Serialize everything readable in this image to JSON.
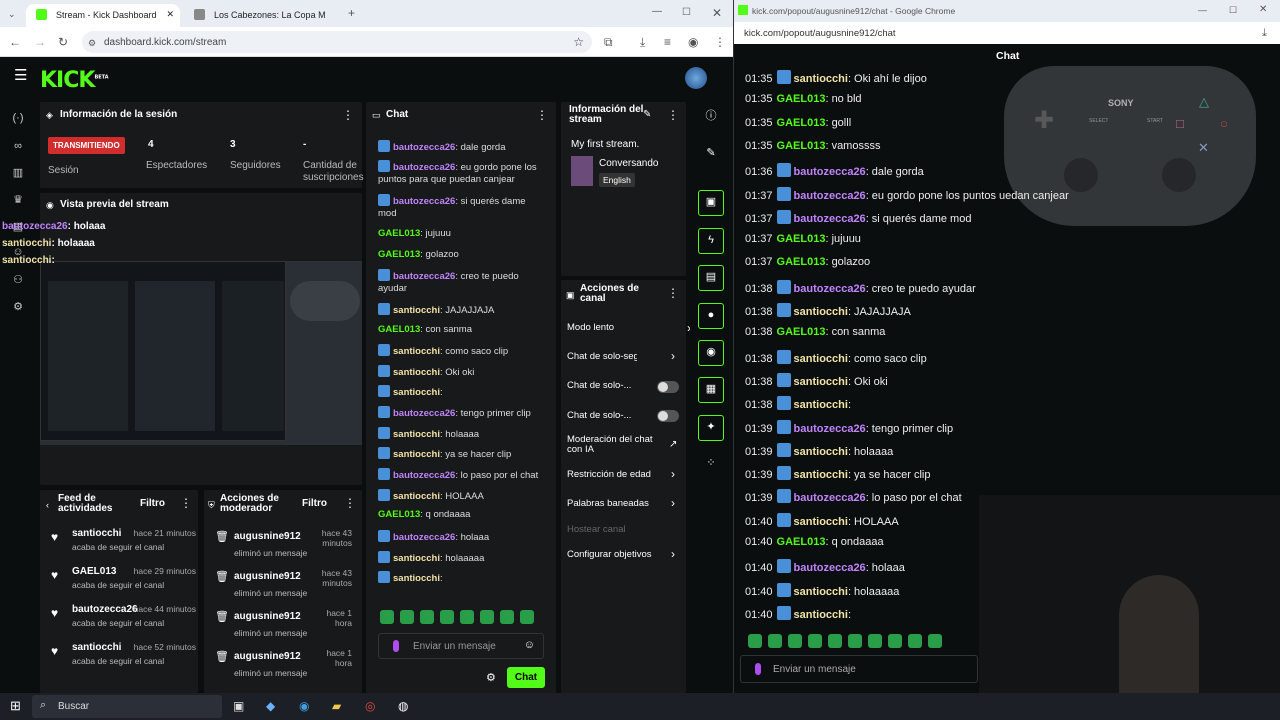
{
  "left_browser": {
    "tab1": "Stream - Kick Dashboard",
    "tab2": "Los Cabezones: La Copa M",
    "url": "dashboard.kick.com/stream"
  },
  "right_browser": {
    "title": "kick.com/popout/augusnine912/chat - Google Chrome",
    "url": "kick.com/popout/augusnine912/chat",
    "chat_title": "Chat"
  },
  "logo": "KICK",
  "logo_beta": "BETA",
  "session": {
    "title": "Información de la sesión",
    "live_label": "TRANSMITIENDO",
    "live_sub": "Sesión",
    "viewers": "4",
    "viewers_label": "Espectadores",
    "followers": "3",
    "followers_label": "Seguidores",
    "subs": "-",
    "subs_label": "Cantidad de suscripciones"
  },
  "preview": {
    "title": "Vista previa del stream",
    "overlay": [
      {
        "user": "bautozecca26",
        "text": ": holaaa"
      },
      {
        "user": "santiocchi",
        "text": ": holaaaa"
      },
      {
        "user": "santiocchi",
        "text": ":"
      }
    ]
  },
  "feed": {
    "title": "Feed de actividades",
    "filter": "Filtro",
    "items": [
      {
        "user": "santiocchi",
        "time": "hace 21 minutos",
        "action": "acaba de seguir el canal"
      },
      {
        "user": "GAEL013",
        "time": "hace 29 minutos",
        "action": "acaba de seguir el canal"
      },
      {
        "user": "bautozecca26",
        "time": "hace 44 minutos",
        "action": "acaba de seguir el canal"
      },
      {
        "user": "santiocchi",
        "time": "hace 52 minutos",
        "action": "acaba de seguir el canal"
      }
    ]
  },
  "modactions": {
    "title": "Acciones de moderador",
    "filter": "Filtro",
    "items": [
      {
        "user": "augusnine912",
        "time": "hace 43 minutos",
        "action": "eliminó un mensaje"
      },
      {
        "user": "augusnine912",
        "time": "hace 43 minutos",
        "action": "eliminó un mensaje"
      },
      {
        "user": "augusnine912",
        "time": "hace 1 hora",
        "action": "eliminó un mensaje"
      },
      {
        "user": "augusnine912",
        "time": "hace 1 hora",
        "action": "eliminó un mensaje"
      }
    ]
  },
  "chat": {
    "title": "Chat",
    "placeholder": "Enviar un mensaje",
    "send": "Chat",
    "messages": [
      {
        "u": "bautozecca26",
        "c": "b",
        "t": ": dale gorda"
      },
      {
        "u": "bautozecca26",
        "c": "b",
        "t": ": eu gordo pone los"
      },
      {
        "u": "",
        "c": "",
        "t": "puntos para que puedan canjear"
      },
      {
        "u": "bautozecca26",
        "c": "b",
        "t": ": si querés dame"
      },
      {
        "u": "",
        "c": "",
        "t": "mod"
      },
      {
        "u": "GAEL013",
        "c": "g",
        "t": ": jujuuu"
      },
      {
        "u": "GAEL013",
        "c": "g",
        "t": ": golazoo"
      },
      {
        "u": "bautozecca26",
        "c": "b",
        "t": ": creo te puedo"
      },
      {
        "u": "",
        "c": "",
        "t": "ayudar"
      },
      {
        "u": "santiocchi",
        "c": "y",
        "t": ": JAJAJJAJA"
      },
      {
        "u": "GAEL013",
        "c": "g",
        "t": ": con sanma"
      },
      {
        "u": "santiocchi",
        "c": "y",
        "t": ": como saco clip"
      },
      {
        "u": "santiocchi",
        "c": "y",
        "t": ": Oki oki"
      },
      {
        "u": "santiocchi",
        "c": "y",
        "t": ":"
      },
      {
        "u": "bautozecca26",
        "c": "b",
        "t": ": tengo primer clip"
      },
      {
        "u": "santiocchi",
        "c": "y",
        "t": ": holaaaa"
      },
      {
        "u": "santiocchi",
        "c": "y",
        "t": ": ya se hacer clip"
      },
      {
        "u": "bautozecca26",
        "c": "b",
        "t": ": lo paso por el chat"
      },
      {
        "u": "santiocchi",
        "c": "y",
        "t": ": HOLAAA"
      },
      {
        "u": "GAEL013",
        "c": "g",
        "t": ": q ondaaaa"
      },
      {
        "u": "bautozecca26",
        "c": "b",
        "t": ": holaaa"
      },
      {
        "u": "santiocchi",
        "c": "y",
        "t": ": holaaaaa"
      },
      {
        "u": "santiocchi",
        "c": "y",
        "t": ":"
      }
    ]
  },
  "streaminfo": {
    "title": "Información del stream",
    "stream_title": "My first stream.",
    "category": "Conversando",
    "lang": "English"
  },
  "channel": {
    "title": "Acciones de canal",
    "items": [
      "Modo lento",
      "Chat de solo-seguido",
      "Chat de solo-...",
      "Chat de solo-...",
      "Moderación del chat con IA",
      "Restricción de edad",
      "Palabras baneadas",
      "Hostear canal",
      "Configurar objetivos"
    ]
  },
  "popout_chat": [
    {
      "time": "01:35",
      "u": "santiocchi",
      "c": "y",
      "t": ": Oki ahí le dijoo"
    },
    {
      "time": "01:35",
      "u": "GAEL013",
      "c": "g",
      "t": ": no bld"
    },
    {
      "time": "01:35",
      "u": "GAEL013",
      "c": "g",
      "t": ": golll"
    },
    {
      "time": "01:35",
      "u": "GAEL013",
      "c": "g",
      "t": ": vamossss"
    },
    {
      "time": "01:36",
      "u": "bautozecca26",
      "c": "b",
      "t": ": dale gorda"
    },
    {
      "time": "01:37",
      "u": "bautozecca26",
      "c": "b",
      "t": ": eu gordo pone los puntos     uedan canjear"
    },
    {
      "time": "01:37",
      "u": "bautozecca26",
      "c": "b",
      "t": ": si querés dame mod"
    },
    {
      "time": "01:37",
      "u": "GAEL013",
      "c": "g",
      "t": ": jujuuu"
    },
    {
      "time": "01:37",
      "u": "GAEL013",
      "c": "g",
      "t": ": golazoo"
    },
    {
      "time": "01:38",
      "u": "bautozecca26",
      "c": "b",
      "t": ": creo te puedo ayudar"
    },
    {
      "time": "01:38",
      "u": "santiocchi",
      "c": "y",
      "t": ": JAJAJJAJA"
    },
    {
      "time": "01:38",
      "u": "GAEL013",
      "c": "g",
      "t": ": con sanma"
    },
    {
      "time": "01:38",
      "u": "santiocchi",
      "c": "y",
      "t": ": como saco clip"
    },
    {
      "time": "01:38",
      "u": "santiocchi",
      "c": "y",
      "t": ": Oki oki"
    },
    {
      "time": "01:38",
      "u": "santiocchi",
      "c": "y",
      "t": ":"
    },
    {
      "time": "01:39",
      "u": "bautozecca26",
      "c": "b",
      "t": ": tengo primer clip"
    },
    {
      "time": "01:39",
      "u": "santiocchi",
      "c": "y",
      "t": ": holaaaa"
    },
    {
      "time": "01:39",
      "u": "santiocchi",
      "c": "y",
      "t": ": ya se hacer clip"
    },
    {
      "time": "01:39",
      "u": "bautozecca26",
      "c": "b",
      "t": ": lo paso por el chat"
    },
    {
      "time": "01:40",
      "u": "santiocchi",
      "c": "y",
      "t": ": HOLAAA"
    },
    {
      "time": "01:40",
      "u": "GAEL013",
      "c": "g",
      "t": ": q ondaaaa"
    },
    {
      "time": "01:40",
      "u": "bautozecca26",
      "c": "b",
      "t": ": holaaa"
    },
    {
      "time": "01:40",
      "u": "santiocchi",
      "c": "y",
      "t": ": holaaaaa"
    },
    {
      "time": "01:40",
      "u": "santiocchi",
      "c": "y",
      "t": ":"
    }
  ],
  "popout_placeholder": "Enviar un mensaje",
  "controller": {
    "brand": "SONY",
    "select": "SELECT",
    "start": "START"
  },
  "taskbar": {
    "search": "Buscar"
  }
}
